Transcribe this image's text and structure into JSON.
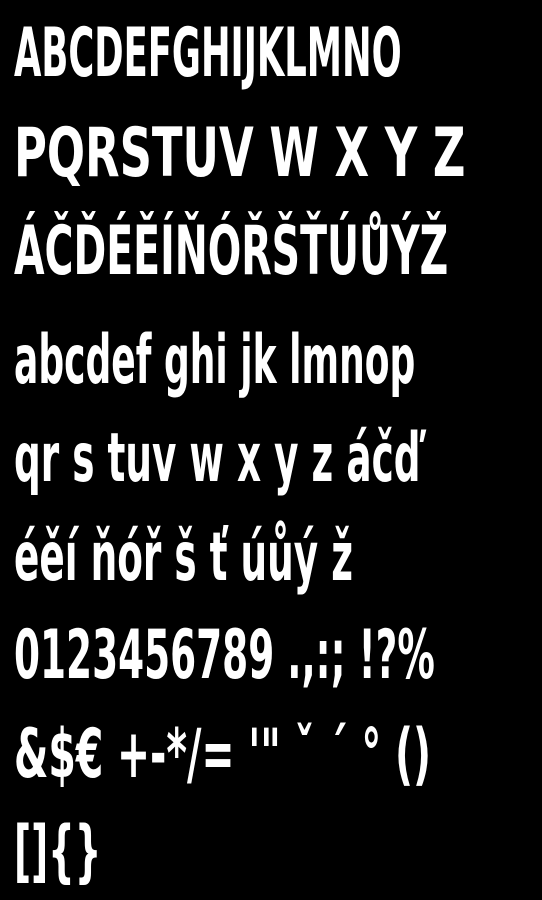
{
  "specimen": {
    "background_color": "#000000",
    "text_color": "#ffffff",
    "lines": [
      "ABCDEFGHIJKLMNO",
      "PQRSTUV W X Y Z",
      "ÁČĎÉĚÍŇÓŘŠŤÚŮÝŽ",
      "abcdef ghi jk lmnop",
      "qr s tuv w x y z áčď",
      "éěí ňóř š ť úůý ž",
      "0123456789 .,:; !?%",
      "&$€ +-*/= '\" ˇ ´ ° ()",
      "[]{}"
    ]
  }
}
